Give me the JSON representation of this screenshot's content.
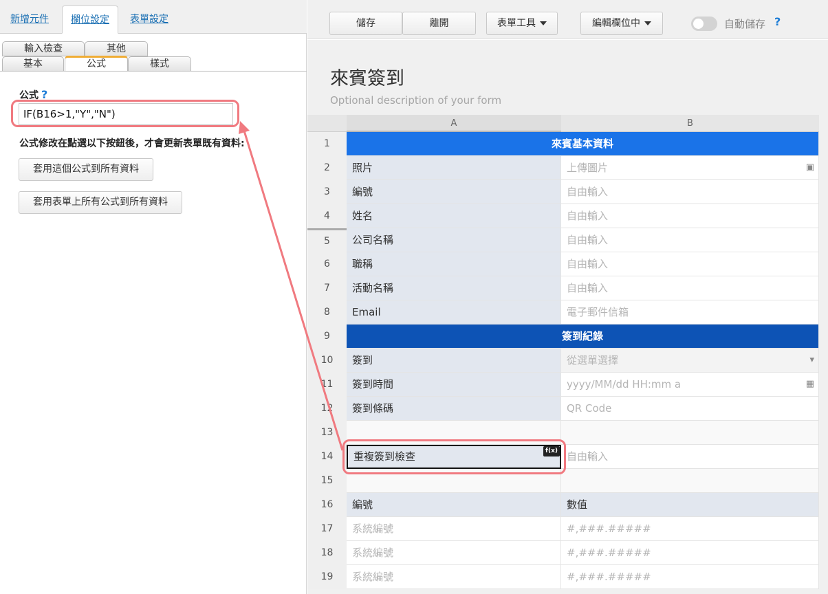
{
  "left_panel": {
    "top_tabs": [
      "新增元件",
      "欄位設定",
      "表單設定"
    ],
    "sub_tabs_row1": [
      "輸入檢查",
      "其他"
    ],
    "sub_tabs_row2": [
      "基本",
      "公式",
      "樣式"
    ],
    "formula_label": "公式",
    "help_mark": "?",
    "formula_value": "IF(B16>1,\"Y\",\"N\")",
    "note": "公式修改在點選以下按鈕後，才會更新表單既有資料:",
    "apply_this_button": "套用這個公式到所有資料",
    "apply_all_button": "套用表單上所有公式到所有資料"
  },
  "toolbar": {
    "save": "儲存",
    "leave": "離開",
    "form_tools": "表單工具",
    "edit_mode": "編輯欄位中",
    "autosave_label": "自動儲存",
    "autosave_on": false,
    "help_mark": "?"
  },
  "form": {
    "title": "來賓簽到",
    "description": "Optional description of your form"
  },
  "grid": {
    "columns": [
      "A",
      "B"
    ],
    "rows": [
      {
        "num": "1",
        "section": "來賓基本資料"
      },
      {
        "num": "2",
        "a": "照片",
        "b": "上傳圖片",
        "icon": "image-icon"
      },
      {
        "num": "3",
        "a": "編號",
        "b": "自由輸入"
      },
      {
        "num": "4",
        "a": "姓名",
        "b": "自由輸入"
      },
      {
        "num": "5",
        "a": "公司名稱",
        "b": "自由輸入"
      },
      {
        "num": "6",
        "a": "職稱",
        "b": "自由輸入"
      },
      {
        "num": "7",
        "a": "活動名稱",
        "b": "自由輸入"
      },
      {
        "num": "8",
        "a": "Email",
        "b": "電子郵件信箱"
      },
      {
        "num": "9",
        "section": "簽到紀錄"
      },
      {
        "num": "10",
        "a": "簽到",
        "b": "從選單選擇",
        "icon": "dropdown-icon"
      },
      {
        "num": "11",
        "a": "簽到時間",
        "b": "yyyy/MM/dd HH:mm a",
        "icon": "calendar-icon"
      },
      {
        "num": "12",
        "a": "簽到條碼",
        "b": "QR Code"
      },
      {
        "num": "13"
      },
      {
        "num": "14",
        "a": "重複簽到檢查",
        "b": "自由輸入",
        "fx": "f(x)"
      },
      {
        "num": "15"
      },
      {
        "num": "16",
        "a": "編號",
        "b": "數值"
      },
      {
        "num": "17",
        "a": "系統編號",
        "b": "#,###.#####"
      },
      {
        "num": "18",
        "a": "系統編號",
        "b": "#,###.#####"
      },
      {
        "num": "19",
        "a": "系統編號",
        "b": "#,###.#####"
      }
    ]
  },
  "colors": {
    "section_blue": "#1a73e8",
    "section_dark_blue": "#0d53b5",
    "highlight": "#f07a80"
  }
}
